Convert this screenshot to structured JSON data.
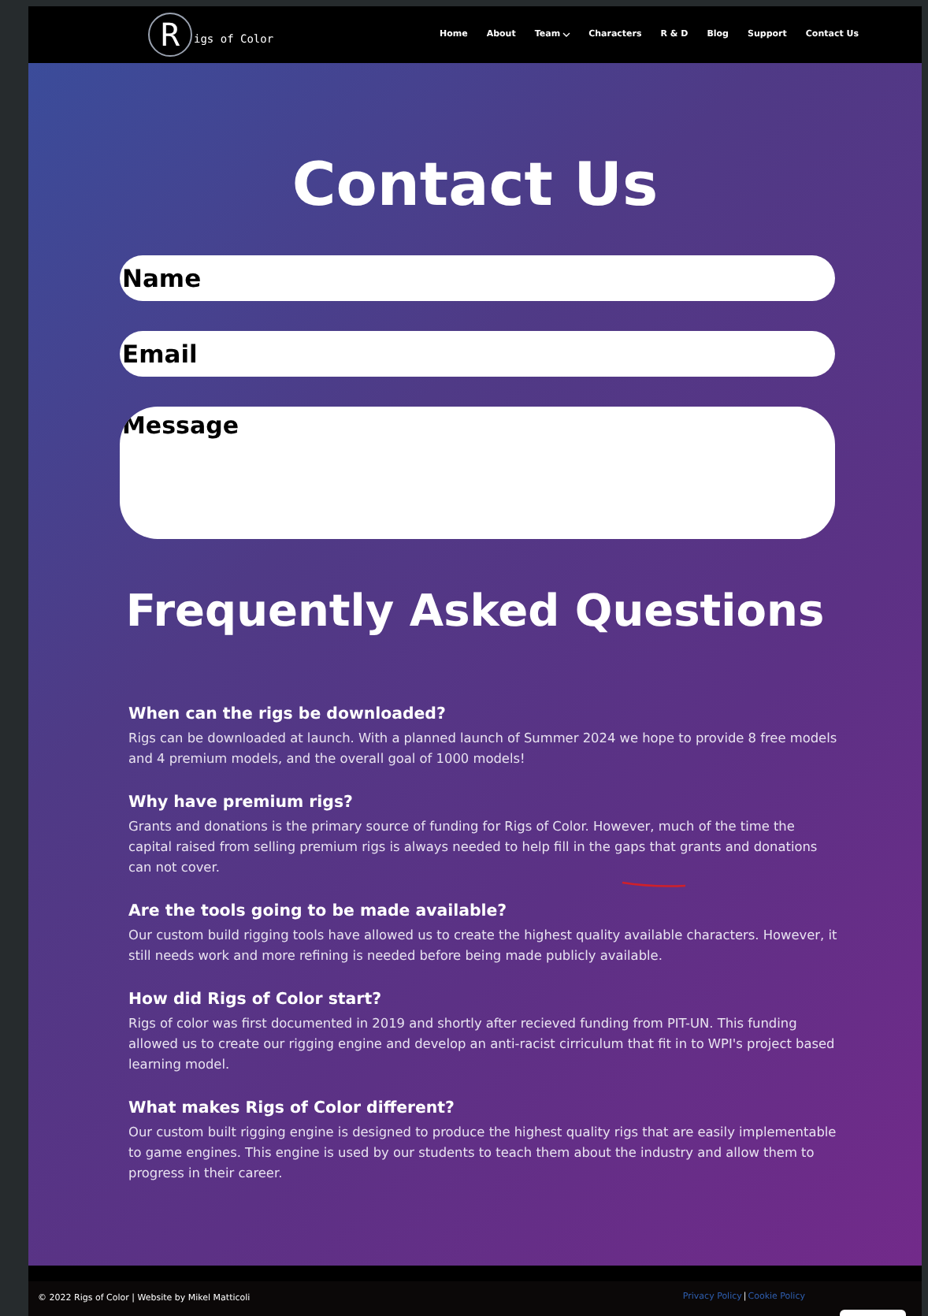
{
  "nav": {
    "logo": {
      "initial": "R",
      "text": "igs of Color"
    },
    "items": [
      {
        "label": "Home",
        "dropdown": false
      },
      {
        "label": "About",
        "dropdown": false
      },
      {
        "label": "Team",
        "dropdown": true
      },
      {
        "label": "Characters",
        "dropdown": false
      },
      {
        "label": "R & D",
        "dropdown": false
      },
      {
        "label": "Blog",
        "dropdown": false
      },
      {
        "label": "Support",
        "dropdown": false
      },
      {
        "label": "Contact Us",
        "dropdown": false
      }
    ]
  },
  "contact": {
    "title": "Contact Us",
    "fields": [
      {
        "kind": "line",
        "placeholder": "Name"
      },
      {
        "kind": "line",
        "placeholder": "Email"
      },
      {
        "kind": "area",
        "placeholder": "Message"
      }
    ]
  },
  "faq": {
    "title": "Frequently Asked Questions",
    "items": [
      {
        "question": "When can the rigs be downloaded?",
        "answer": "Rigs can be downloaded at launch.  With a planned launch of Summer 2024 we hope to provide 8 free models and 4 premium models, and the overall goal of 1000 models!"
      },
      {
        "question": "Why have premium rigs?",
        "answer": "Grants and donations is the primary source of funding for Rigs of Color.  However, much of the time the capital raised from selling premium rigs is always needed to help fill in the gaps that grants and donations can not cover."
      },
      {
        "question": "Are the tools going to be made available?",
        "answer": "Our custom build rigging tools have allowed us to create the highest quality available characters.  However, it still needs work and more refining is needed before being made publicly available."
      },
      {
        "question": "How did Rigs of Color start?",
        "answer": "Rigs of color was first documented in 2019 and shortly after recieved funding from PIT-UN.  This funding allowed us to create our rigging engine and develop an anti-racist cirriculum that fit in to WPI's project based learning model."
      },
      {
        "question": "What makes Rigs of Color different?",
        "answer": "Our custom built rigging engine is designed to produce the highest quality rigs that are easily implementable to game engines.  This engine is used by our students to teach them about the industry and allow them to progress in their career."
      }
    ]
  },
  "footer": {
    "copyright": "© 2022 Rigs of Color | Website by Mikel Matticoli",
    "links": [
      "Privacy Policy",
      "Cookie Policy"
    ],
    "separator": "|"
  }
}
